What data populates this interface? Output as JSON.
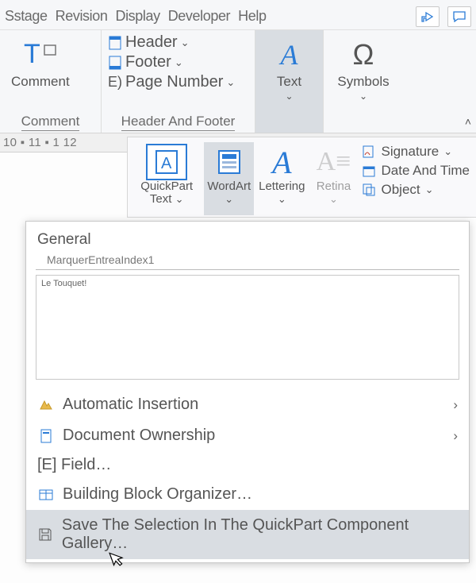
{
  "menu": {
    "items": [
      "Sstage",
      "Revision",
      "Display",
      "Developer",
      "Help"
    ]
  },
  "ribbon": {
    "comment": {
      "label": "Comment",
      "group": "Comment"
    },
    "hf": {
      "header": "Header",
      "footer": "Footer",
      "pagenum": "Page Number",
      "pagenum_prefix": "E)",
      "group": "Header And Footer"
    },
    "text": {
      "label": "Text"
    },
    "symbols": {
      "label": "Symbols",
      "glyph": "Ω"
    }
  },
  "ruler": "10 ▪ 11 ▪ 1 12",
  "tool2": {
    "quickpart": "QuickPart Text",
    "wordart": "WordArt",
    "lettering": "Lettering",
    "retina": "Retina",
    "a_glyph": "A",
    "signature": "Signature",
    "datetime": "Date And Time",
    "object": "Object"
  },
  "panel": {
    "section": "General",
    "entry": "MarquerEntreaIndex1",
    "preview": "Le Touquet!",
    "auto_insert": "Automatic Insertion",
    "doc_owner": "Document Ownership",
    "field": "[E] Field…",
    "bbo": "Building Block Organizer…",
    "save": "Save The Selection In The QuickPart Component Gallery…"
  }
}
